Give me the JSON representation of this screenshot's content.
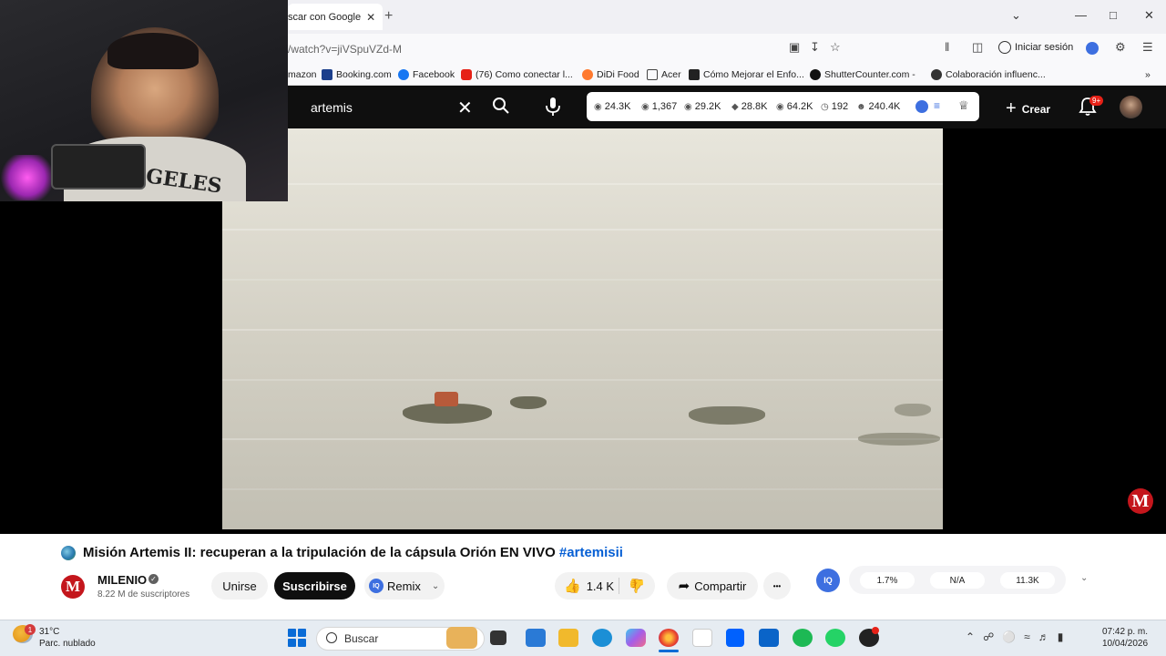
{
  "browser": {
    "tab_title": "scar con Google",
    "tab_close": "✕",
    "new_tab": "+",
    "url": "/watch?v=jiVSpuVZd-M",
    "signin_label": "Iniciar sesión",
    "bookmarks": [
      {
        "label": "mazon",
        "icon": "amazon-icon"
      },
      {
        "label": "Booking.com",
        "icon": "booking-icon"
      },
      {
        "label": "Facebook",
        "icon": "facebook-icon"
      },
      {
        "label": "(76) Como conectar l...",
        "icon": "youtube-icon"
      },
      {
        "label": "DiDi Food",
        "icon": "didi-icon"
      },
      {
        "label": "Acer",
        "icon": "folder-icon"
      },
      {
        "label": "Cómo Mejorar el Enfo...",
        "icon": "page-icon"
      },
      {
        "label": "ShutterCounter.com -",
        "icon": "shutter-icon"
      },
      {
        "label": "Colaboración influenc...",
        "icon": "collab-icon"
      }
    ],
    "more_bookmarks": "»"
  },
  "youtube": {
    "search_value": "artemis",
    "stats": [
      {
        "icon": "views-icon",
        "value": "24.3K"
      },
      {
        "icon": "eye-icon",
        "value": "1,367"
      },
      {
        "icon": "eye-icon",
        "value": "29.2K"
      },
      {
        "icon": "tag-icon",
        "value": "28.8K"
      },
      {
        "icon": "eye-icon",
        "value": "64.2K"
      },
      {
        "icon": "clock-icon",
        "value": "192"
      },
      {
        "icon": "user-icon",
        "value": "240.4K"
      }
    ],
    "create_label": "Crear",
    "notification_badge": "9+"
  },
  "video": {
    "channel_logo_text": "M",
    "title": "Misión Artemis II: recuperan a la tripulación de la cápsula Orión EN VIVO",
    "hashtag": "#artemisii",
    "channel_name": "MILENIO",
    "subscribers": "8.22 M de suscriptores",
    "join_label": "Unirse",
    "subscribe_label": "Suscribirse",
    "remix_label": "Remix",
    "likes": "1.4 K",
    "share_label": "Compartir",
    "more_label": "•••"
  },
  "webcam": {
    "shirt_text": "GELES"
  },
  "iq_panel": {
    "iq_label": "IQ",
    "values": [
      "1.7%",
      "N/A",
      "11.3K"
    ]
  },
  "taskbar": {
    "weather_badge": "1",
    "temperature": "31°C",
    "weather_desc": "Parc. nublado",
    "search_placeholder": "Buscar",
    "time": "07:42 p. m.",
    "date": "10/04/2026"
  }
}
